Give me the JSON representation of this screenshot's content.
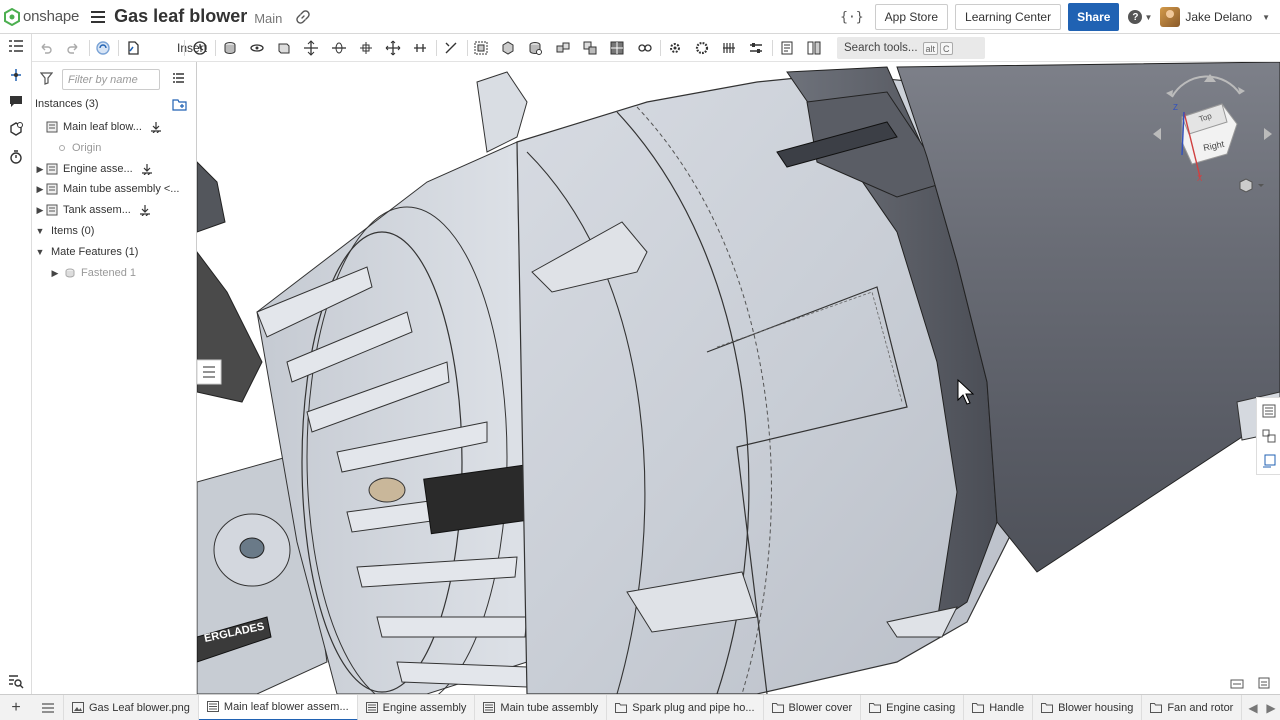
{
  "app": {
    "logo_text": "onshape",
    "document_title": "Gas leaf blower",
    "branch": "Main",
    "brand_color": "#2062b3"
  },
  "header": {
    "featurescript_label": "{·}",
    "app_store_label": "App Store",
    "learning_center_label": "Learning Center",
    "share_label": "Share",
    "help_label": "?",
    "user_name": "Jake Delano"
  },
  "toolbar": {
    "insert_label": "Insert",
    "search_label": "Search tools...",
    "search_shortcut_1": "alt",
    "search_shortcut_2": "C"
  },
  "panel": {
    "filter_placeholder": "Filter by name",
    "instances_header": "Instances (3)",
    "instances": [
      {
        "label": "Main leaf blow...",
        "expandable": false
      },
      {
        "label": "Origin",
        "expandable": false
      },
      {
        "label": "Engine asse...",
        "expandable": true
      },
      {
        "label": "Main tube assembly <...",
        "expandable": true
      },
      {
        "label": "Tank assem...",
        "expandable": true
      }
    ],
    "items_header": "Items (0)",
    "mates_header": "Mate Features (1)",
    "mates": [
      {
        "label": "Fastened 1"
      }
    ]
  },
  "viewcube": {
    "face_top": "Top",
    "face_right": "Right",
    "axis_x": "X",
    "axis_z": "Z"
  },
  "viewport": {
    "label_text": "ERGLADES"
  },
  "tabs": [
    {
      "label": "Gas Leaf blower.png",
      "icon": "image-icon",
      "active": false
    },
    {
      "label": "Main leaf blower assem...",
      "icon": "assembly-icon",
      "active": true
    },
    {
      "label": "Engine assembly",
      "icon": "assembly-icon",
      "active": false
    },
    {
      "label": "Main tube assembly",
      "icon": "assembly-icon",
      "active": false
    },
    {
      "label": "Spark plug and pipe ho...",
      "icon": "folder-icon",
      "active": false
    },
    {
      "label": "Blower cover",
      "icon": "folder-icon",
      "active": false
    },
    {
      "label": "Engine casing",
      "icon": "folder-icon",
      "active": false
    },
    {
      "label": "Handle",
      "icon": "folder-icon",
      "active": false
    },
    {
      "label": "Blower housing",
      "icon": "folder-icon",
      "active": false
    },
    {
      "label": "Fan and rotor",
      "icon": "folder-icon",
      "active": false
    }
  ]
}
